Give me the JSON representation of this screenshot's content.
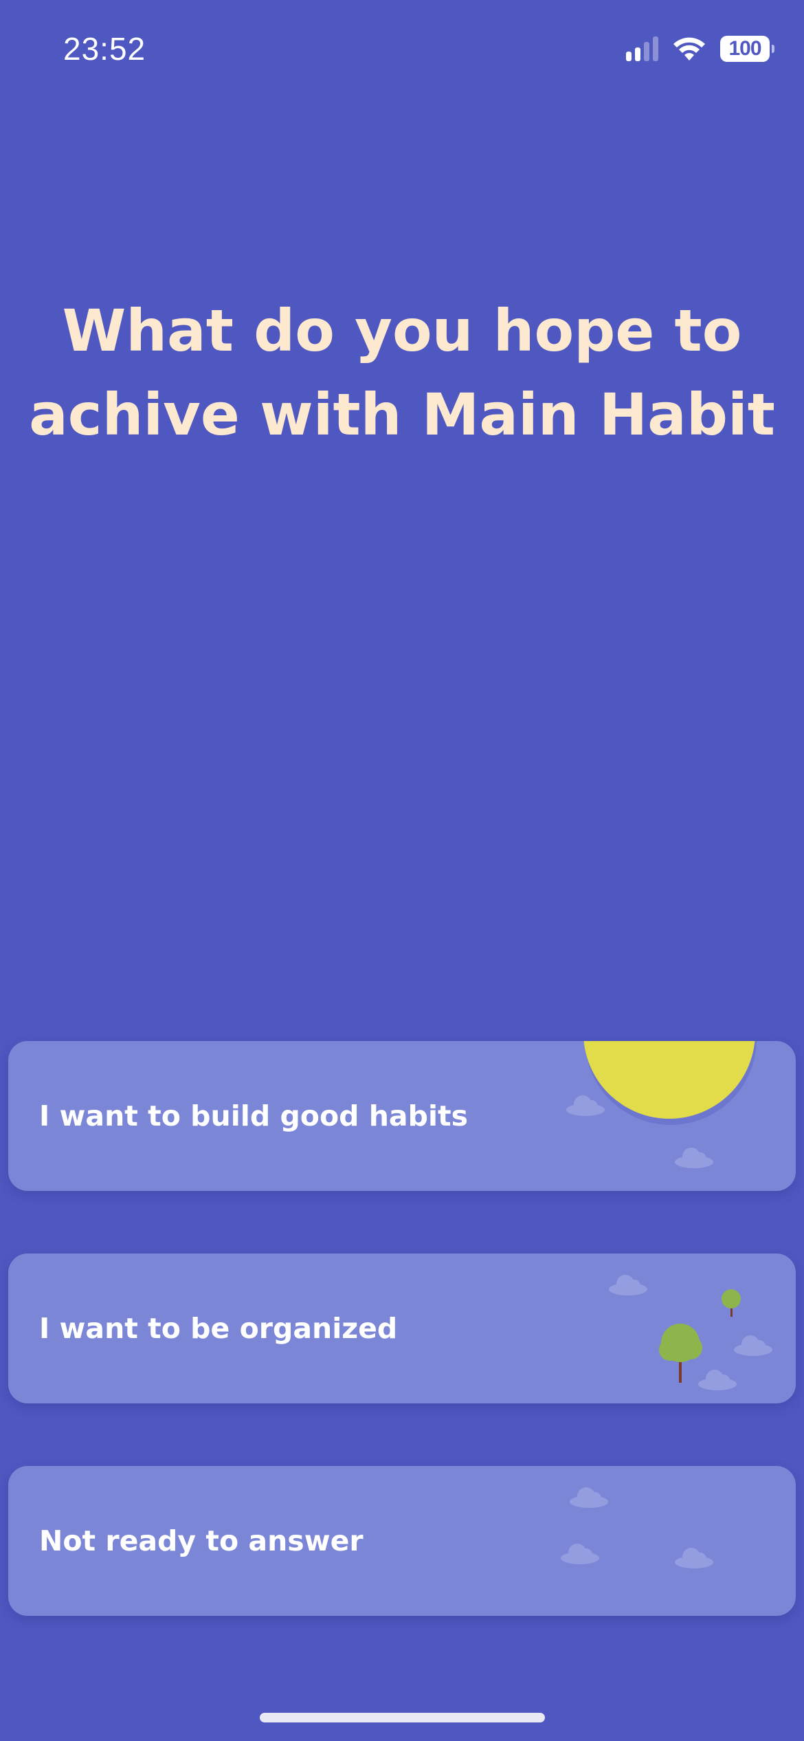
{
  "status_bar": {
    "time": "23:52",
    "battery": "100",
    "icons": [
      "cellular-signal-icon",
      "wifi-icon",
      "battery-icon"
    ]
  },
  "question": {
    "title": "What do you hope to achive with Main Habit"
  },
  "options": [
    {
      "label": "I want to build good habits",
      "art": "sun-illustration"
    },
    {
      "label": "I want to be organized",
      "art": "trees-illustration"
    },
    {
      "label": "Not ready to answer",
      "art": "clouds-illustration"
    }
  ],
  "colors": {
    "background": "#4F57C1",
    "card": "#7B86D7",
    "title": "#FCE9CF",
    "sun": "#E3DC4A",
    "tree": "#8DB54B",
    "cloud": "#939DE0"
  }
}
